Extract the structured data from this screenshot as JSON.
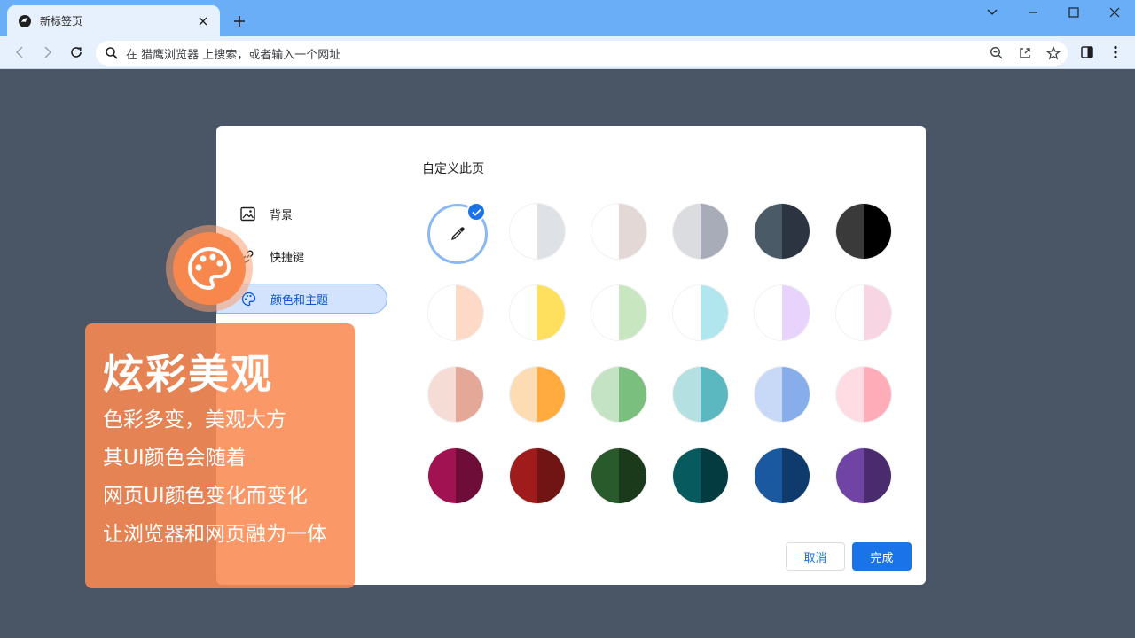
{
  "browser": {
    "tab": {
      "title": "新标签页"
    },
    "omnibox": {
      "placeholder": "在 猎鹰浏览器 上搜索，或者输入一个网址"
    }
  },
  "dialog": {
    "title": "自定义此页",
    "nav": [
      {
        "label": "背景",
        "icon": "image-icon"
      },
      {
        "label": "快捷键",
        "icon": "link-icon"
      },
      {
        "label": "颜色和主题",
        "icon": "palette-icon",
        "active": true
      }
    ],
    "swatches": [
      {
        "id": "custom",
        "left": "#bcd6fb",
        "right": "#63a6f7",
        "selected": true
      },
      {
        "id": "default-light",
        "left": "#ffffff",
        "right": "#dee1e6"
      },
      {
        "id": "warm-grey",
        "left": "#ffffff",
        "right": "#e3d8d5"
      },
      {
        "id": "cool-grey",
        "left": "#dadce0",
        "right": "#a8abb8"
      },
      {
        "id": "blue-grey",
        "left": "#4b5a67",
        "right": "#2b3440"
      },
      {
        "id": "black",
        "left": "#3a3a3a",
        "right": "#000000"
      },
      {
        "id": "peach-light",
        "left": "#ffffff",
        "right": "#fdd9c8"
      },
      {
        "id": "yellow",
        "left": "#ffffff",
        "right": "#ffdf5e"
      },
      {
        "id": "green-light",
        "left": "#ffffff",
        "right": "#c8e6c0"
      },
      {
        "id": "cyan-light",
        "left": "#ffffff",
        "right": "#b2e6ef"
      },
      {
        "id": "lavender",
        "left": "#ffffff",
        "right": "#e8d3fc"
      },
      {
        "id": "pink-light",
        "left": "#ffffff",
        "right": "#f7d5e3"
      },
      {
        "id": "rose",
        "left": "#f5ddd6",
        "right": "#e3a898"
      },
      {
        "id": "orange",
        "left": "#fddcb3",
        "right": "#ffab40"
      },
      {
        "id": "green",
        "left": "#c4e2c4",
        "right": "#7bbf7e"
      },
      {
        "id": "teal",
        "left": "#b4e0e2",
        "right": "#5cb8c0"
      },
      {
        "id": "periwinkle",
        "left": "#c8d9f7",
        "right": "#87aeea"
      },
      {
        "id": "pink",
        "left": "#ffdbe3",
        "right": "#ffacb9"
      },
      {
        "id": "crimson",
        "left": "#a01252",
        "right": "#6e0d38"
      },
      {
        "id": "red",
        "left": "#a01c1c",
        "right": "#711514"
      },
      {
        "id": "forest",
        "left": "#295a2c",
        "right": "#1b3a1c"
      },
      {
        "id": "dark-teal",
        "left": "#075b5e",
        "right": "#033b40"
      },
      {
        "id": "navy",
        "left": "#1a58a0",
        "right": "#0f3a6c"
      },
      {
        "id": "purple",
        "left": "#6f44a5",
        "right": "#4a2b6e"
      }
    ],
    "cancel_label": "取消",
    "done_label": "完成"
  },
  "promo": {
    "title": "炫彩美观",
    "lines": [
      "色彩多变，美观大方",
      "其UI颜色会随着",
      "网页UI颜色变化而变化",
      "让浏览器和网页融为一体"
    ]
  },
  "colors": {
    "accent": "#1a73e8",
    "frame": "#6aaef7",
    "toolbar": "#e7f1fd",
    "backdrop": "#4a5565",
    "promo": "#fa8a52"
  }
}
